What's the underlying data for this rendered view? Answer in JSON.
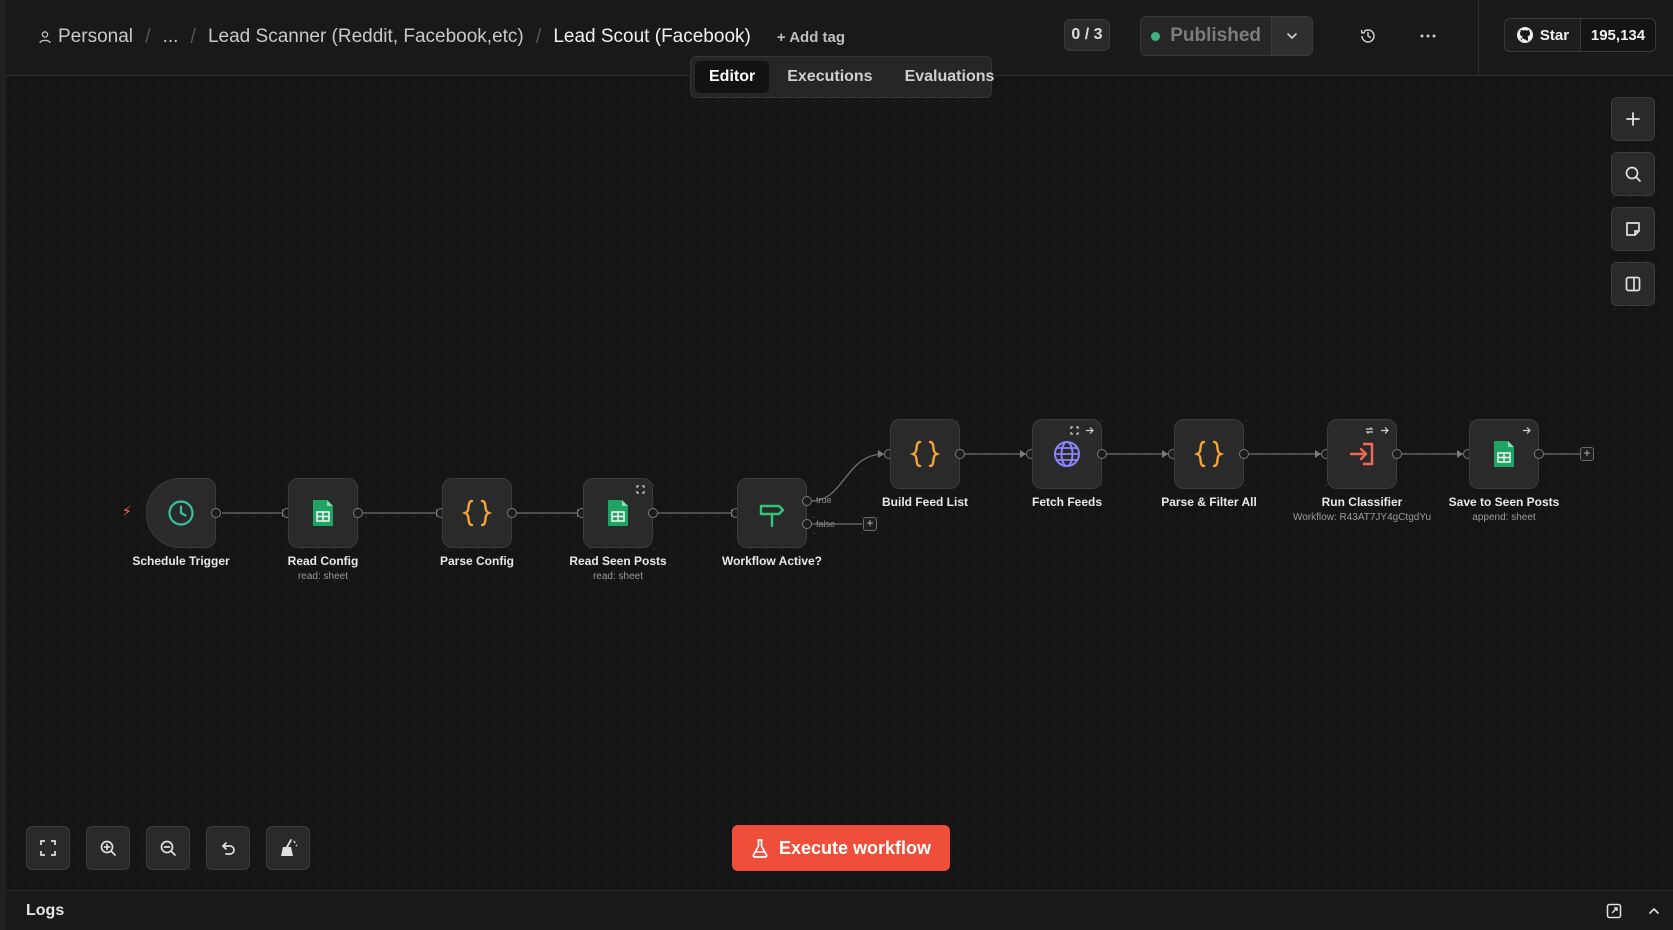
{
  "header": {
    "breadcrumb": {
      "project": "Personal",
      "ellipsis": "...",
      "folder": "Lead Scanner (Reddit, Facebook,etc)",
      "workflow": "Lead Scout (Facebook)"
    },
    "separator": "/",
    "add_tag": "+ Add tag",
    "counter": "0 / 3",
    "publish_label": "Published",
    "github_star_label": "Star",
    "github_star_count": "195,134"
  },
  "tabs": [
    {
      "label": "Editor",
      "active": true
    },
    {
      "label": "Executions",
      "active": false
    },
    {
      "label": "Evaluations",
      "active": false
    }
  ],
  "nodes": [
    {
      "id": "schedule",
      "label": "Schedule Trigger",
      "sub": "",
      "icon": "clock-icon"
    },
    {
      "id": "readconfig",
      "label": "Read Config",
      "sub": "read: sheet",
      "icon": "google-sheets-icon"
    },
    {
      "id": "parseconfig",
      "label": "Parse Config",
      "sub": "",
      "icon": "code-braces-icon"
    },
    {
      "id": "readseen",
      "label": "Read Seen Posts",
      "sub": "read: sheet",
      "icon": "google-sheets-icon"
    },
    {
      "id": "active",
      "label": "Workflow Active?",
      "sub": "",
      "icon": "signpost-icon"
    },
    {
      "id": "buildfeed",
      "label": "Build Feed List",
      "sub": "",
      "icon": "code-braces-icon"
    },
    {
      "id": "fetch",
      "label": "Fetch Feeds",
      "sub": "",
      "icon": "globe-icon"
    },
    {
      "id": "parsefilter",
      "label": "Parse & Filter All",
      "sub": "",
      "icon": "code-braces-icon"
    },
    {
      "id": "classifier",
      "label": "Run Classifier",
      "sub": "Workflow: R43AT7JY4gCtgdYu",
      "icon": "execute-workflow-icon"
    },
    {
      "id": "save",
      "label": "Save to Seen Posts",
      "sub": "append: sheet",
      "icon": "google-sheets-icon"
    }
  ],
  "branches": {
    "true_label": "true",
    "false_label": "false"
  },
  "execute_button": "Execute workflow",
  "logs": {
    "title": "Logs"
  },
  "colors": {
    "accent": "#ef4f3a",
    "published_dot": "#3fb27a",
    "sheets_green": "#20a463",
    "code_orange": "#f2a33a",
    "globe_purple": "#8b84ff",
    "signpost_green": "#35c37a",
    "trigger_teal": "#3cc0a0"
  }
}
